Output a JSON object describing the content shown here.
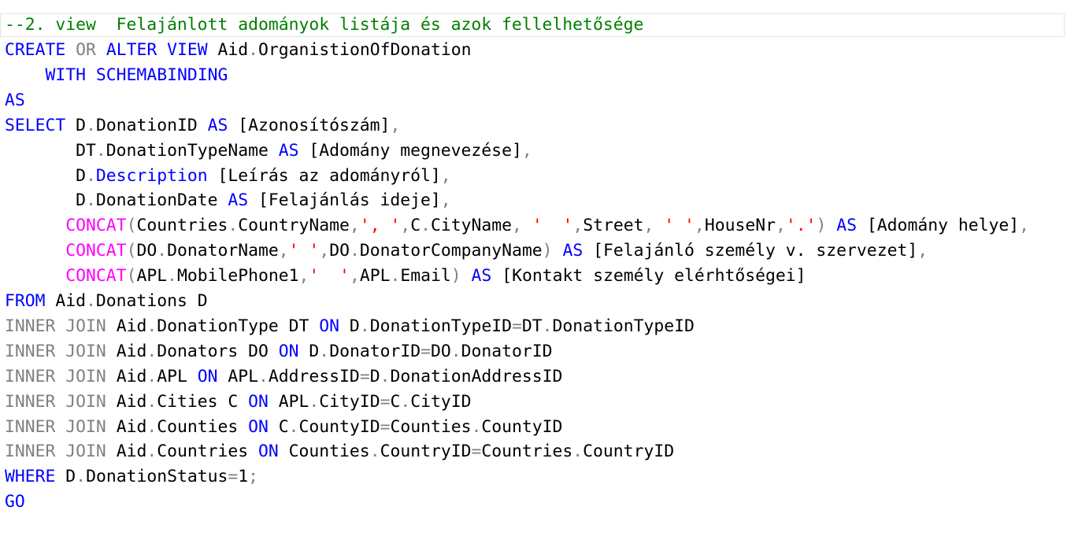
{
  "colors": {
    "keyword": "#0000ff",
    "operator": "#808080",
    "function": "#ff00ff",
    "string": "#ff0000",
    "comment": "#008000",
    "text": "#000000"
  },
  "code": {
    "comment": "--2. view  Felajánlott adományok listája és azok fellelhetősége",
    "lines": [
      [
        {
          "t": "CREATE",
          "c": "kw"
        },
        {
          "t": " "
        },
        {
          "t": "OR",
          "c": "gray"
        },
        {
          "t": " "
        },
        {
          "t": "ALTER",
          "c": "kw"
        },
        {
          "t": " "
        },
        {
          "t": "VIEW",
          "c": "kw"
        },
        {
          "t": " Aid"
        },
        {
          "t": ".",
          "c": "gray"
        },
        {
          "t": "OrganistionOfDonation"
        }
      ],
      [
        {
          "t": "    "
        },
        {
          "t": "WITH",
          "c": "kw"
        },
        {
          "t": " "
        },
        {
          "t": "SCHEMABINDING",
          "c": "kw"
        }
      ],
      [
        {
          "t": "AS",
          "c": "kw"
        }
      ],
      [
        {
          "t": "SELECT",
          "c": "kw"
        },
        {
          "t": " D"
        },
        {
          "t": ".",
          "c": "gray"
        },
        {
          "t": "DonationID "
        },
        {
          "t": "AS",
          "c": "kw"
        },
        {
          "t": " [Azonosítószám]"
        },
        {
          "t": ",",
          "c": "gray"
        }
      ],
      [
        {
          "t": "       DT"
        },
        {
          "t": ".",
          "c": "gray"
        },
        {
          "t": "DonationTypeName "
        },
        {
          "t": "AS",
          "c": "kw"
        },
        {
          "t": " [Adomány megnevezése]"
        },
        {
          "t": ",",
          "c": "gray"
        }
      ],
      [
        {
          "t": "       D"
        },
        {
          "t": ".",
          "c": "gray"
        },
        {
          "t": "Description",
          "c": "kw"
        },
        {
          "t": " [Leírás az adományról]"
        },
        {
          "t": ",",
          "c": "gray"
        }
      ],
      [
        {
          "t": "       D"
        },
        {
          "t": ".",
          "c": "gray"
        },
        {
          "t": "DonationDate "
        },
        {
          "t": "AS",
          "c": "kw"
        },
        {
          "t": " [Felajánlás ideje]"
        },
        {
          "t": ",",
          "c": "gray"
        }
      ],
      [
        {
          "t": "      "
        },
        {
          "t": "CONCAT",
          "c": "fn"
        },
        {
          "t": "(",
          "c": "gray"
        },
        {
          "t": "Countries"
        },
        {
          "t": ".",
          "c": "gray"
        },
        {
          "t": "CountryName"
        },
        {
          "t": ",",
          "c": "gray"
        },
        {
          "t": "', '",
          "c": "str"
        },
        {
          "t": ",",
          "c": "gray"
        },
        {
          "t": "C"
        },
        {
          "t": ".",
          "c": "gray"
        },
        {
          "t": "CityName"
        },
        {
          "t": ",",
          "c": "gray"
        },
        {
          "t": " "
        },
        {
          "t": "'  '",
          "c": "str"
        },
        {
          "t": ",",
          "c": "gray"
        },
        {
          "t": "Street"
        },
        {
          "t": ",",
          "c": "gray"
        },
        {
          "t": " "
        },
        {
          "t": "' '",
          "c": "str"
        },
        {
          "t": ",",
          "c": "gray"
        },
        {
          "t": "HouseNr"
        },
        {
          "t": ",",
          "c": "gray"
        },
        {
          "t": "'.'",
          "c": "str"
        },
        {
          "t": ")",
          "c": "gray"
        },
        {
          "t": " "
        },
        {
          "t": "AS",
          "c": "kw"
        },
        {
          "t": " [Adomány helye]"
        },
        {
          "t": ",",
          "c": "gray"
        }
      ],
      [
        {
          "t": "      "
        },
        {
          "t": "CONCAT",
          "c": "fn"
        },
        {
          "t": "(",
          "c": "gray"
        },
        {
          "t": "DO"
        },
        {
          "t": ".",
          "c": "gray"
        },
        {
          "t": "DonatorName"
        },
        {
          "t": ",",
          "c": "gray"
        },
        {
          "t": "' '",
          "c": "str"
        },
        {
          "t": ",",
          "c": "gray"
        },
        {
          "t": "DO"
        },
        {
          "t": ".",
          "c": "gray"
        },
        {
          "t": "DonatorCompanyName"
        },
        {
          "t": ")",
          "c": "gray"
        },
        {
          "t": " "
        },
        {
          "t": "AS",
          "c": "kw"
        },
        {
          "t": " [Felajánló személy v. szervezet]"
        },
        {
          "t": ",",
          "c": "gray"
        }
      ],
      [
        {
          "t": "      "
        },
        {
          "t": "CONCAT",
          "c": "fn"
        },
        {
          "t": "(",
          "c": "gray"
        },
        {
          "t": "APL"
        },
        {
          "t": ".",
          "c": "gray"
        },
        {
          "t": "MobilePhone1"
        },
        {
          "t": ",",
          "c": "gray"
        },
        {
          "t": "'  '",
          "c": "str"
        },
        {
          "t": ",",
          "c": "gray"
        },
        {
          "t": "APL"
        },
        {
          "t": ".",
          "c": "gray"
        },
        {
          "t": "Email"
        },
        {
          "t": ")",
          "c": "gray"
        },
        {
          "t": " "
        },
        {
          "t": "AS",
          "c": "kw"
        },
        {
          "t": " [Kontakt személy elérhtőségei]"
        }
      ],
      [
        {
          "t": "FROM",
          "c": "kw"
        },
        {
          "t": " Aid"
        },
        {
          "t": ".",
          "c": "gray"
        },
        {
          "t": "Donations D"
        }
      ],
      [
        {
          "t": "INNER",
          "c": "gray"
        },
        {
          "t": " "
        },
        {
          "t": "JOIN",
          "c": "gray"
        },
        {
          "t": " Aid"
        },
        {
          "t": ".",
          "c": "gray"
        },
        {
          "t": "DonationType DT "
        },
        {
          "t": "ON",
          "c": "kw"
        },
        {
          "t": " D"
        },
        {
          "t": ".",
          "c": "gray"
        },
        {
          "t": "DonationTypeID"
        },
        {
          "t": "=",
          "c": "gray"
        },
        {
          "t": "DT"
        },
        {
          "t": ".",
          "c": "gray"
        },
        {
          "t": "DonationTypeID"
        }
      ],
      [
        {
          "t": "INNER",
          "c": "gray"
        },
        {
          "t": " "
        },
        {
          "t": "JOIN",
          "c": "gray"
        },
        {
          "t": " Aid"
        },
        {
          "t": ".",
          "c": "gray"
        },
        {
          "t": "Donators DO "
        },
        {
          "t": "ON",
          "c": "kw"
        },
        {
          "t": " D"
        },
        {
          "t": ".",
          "c": "gray"
        },
        {
          "t": "DonatorID"
        },
        {
          "t": "=",
          "c": "gray"
        },
        {
          "t": "DO"
        },
        {
          "t": ".",
          "c": "gray"
        },
        {
          "t": "DonatorID"
        }
      ],
      [
        {
          "t": "INNER",
          "c": "gray"
        },
        {
          "t": " "
        },
        {
          "t": "JOIN",
          "c": "gray"
        },
        {
          "t": " Aid"
        },
        {
          "t": ".",
          "c": "gray"
        },
        {
          "t": "APL "
        },
        {
          "t": "ON",
          "c": "kw"
        },
        {
          "t": " APL"
        },
        {
          "t": ".",
          "c": "gray"
        },
        {
          "t": "AddressID"
        },
        {
          "t": "=",
          "c": "gray"
        },
        {
          "t": "D"
        },
        {
          "t": ".",
          "c": "gray"
        },
        {
          "t": "DonationAddressID"
        }
      ],
      [
        {
          "t": "INNER",
          "c": "gray"
        },
        {
          "t": " "
        },
        {
          "t": "JOIN",
          "c": "gray"
        },
        {
          "t": " Aid"
        },
        {
          "t": ".",
          "c": "gray"
        },
        {
          "t": "Cities C "
        },
        {
          "t": "ON",
          "c": "kw"
        },
        {
          "t": " APL"
        },
        {
          "t": ".",
          "c": "gray"
        },
        {
          "t": "CityID"
        },
        {
          "t": "=",
          "c": "gray"
        },
        {
          "t": "C"
        },
        {
          "t": ".",
          "c": "gray"
        },
        {
          "t": "CityID"
        }
      ],
      [
        {
          "t": "INNER",
          "c": "gray"
        },
        {
          "t": " "
        },
        {
          "t": "JOIN",
          "c": "gray"
        },
        {
          "t": " Aid"
        },
        {
          "t": ".",
          "c": "gray"
        },
        {
          "t": "Counties "
        },
        {
          "t": "ON",
          "c": "kw"
        },
        {
          "t": " C"
        },
        {
          "t": ".",
          "c": "gray"
        },
        {
          "t": "CountyID"
        },
        {
          "t": "=",
          "c": "gray"
        },
        {
          "t": "Counties"
        },
        {
          "t": ".",
          "c": "gray"
        },
        {
          "t": "CountyID"
        }
      ],
      [
        {
          "t": "INNER",
          "c": "gray"
        },
        {
          "t": " "
        },
        {
          "t": "JOIN",
          "c": "gray"
        },
        {
          "t": " Aid"
        },
        {
          "t": ".",
          "c": "gray"
        },
        {
          "t": "Countries "
        },
        {
          "t": "ON",
          "c": "kw"
        },
        {
          "t": " Counties"
        },
        {
          "t": ".",
          "c": "gray"
        },
        {
          "t": "CountryID"
        },
        {
          "t": "=",
          "c": "gray"
        },
        {
          "t": "Countries"
        },
        {
          "t": ".",
          "c": "gray"
        },
        {
          "t": "CountryID"
        }
      ],
      [
        {
          "t": "WHERE",
          "c": "kw"
        },
        {
          "t": " D"
        },
        {
          "t": ".",
          "c": "gray"
        },
        {
          "t": "DonationStatus"
        },
        {
          "t": "=",
          "c": "gray"
        },
        {
          "t": "1"
        },
        {
          "t": ";",
          "c": "gray"
        }
      ],
      [
        {
          "t": "GO",
          "c": "kw"
        }
      ]
    ]
  }
}
